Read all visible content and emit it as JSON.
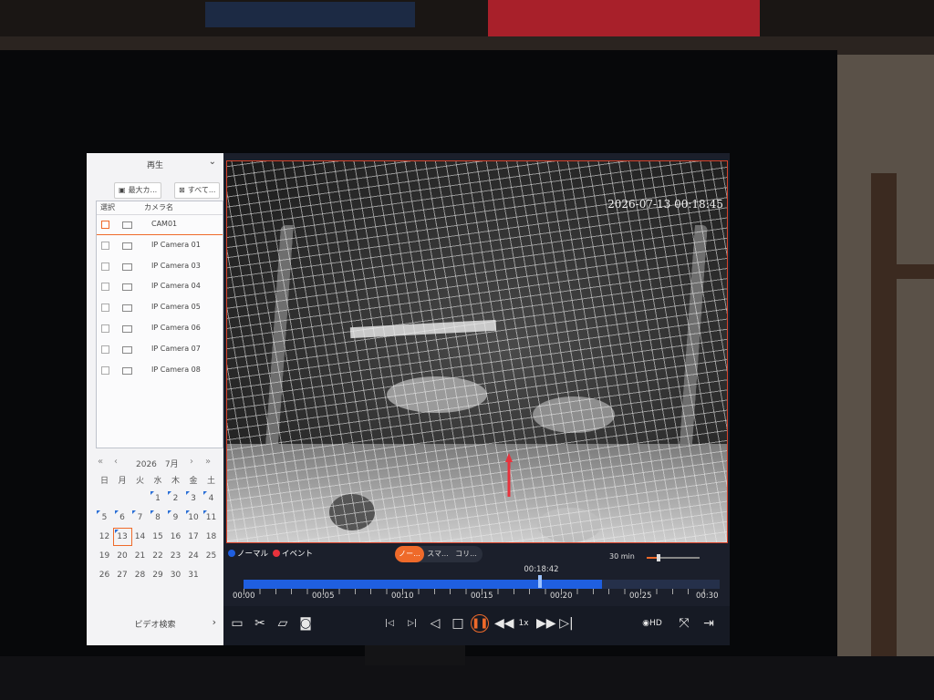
{
  "colors": {
    "accent": "#ef6a2a",
    "normal": "#1f5fe0",
    "event": "#e8323c"
  },
  "sidebar": {
    "title": "再生",
    "buttons": [
      {
        "label": "最大カ...",
        "icon": "grid-icon"
      },
      {
        "label": "すべて...",
        "icon": "close-all-icon"
      }
    ],
    "list_header": {
      "select": "選択",
      "camera": "カメラ名"
    },
    "cameras": [
      {
        "name": "CAM01",
        "active": true
      },
      {
        "name": "IP Camera 01"
      },
      {
        "name": "IP Camera 03"
      },
      {
        "name": "IP Camera 04"
      },
      {
        "name": "IP Camera 05"
      },
      {
        "name": "IP Camera 06"
      },
      {
        "name": "IP Camera 07"
      },
      {
        "name": "IP Camera 08"
      }
    ],
    "calendar": {
      "year": "2026",
      "month": "7月",
      "nav": [
        "«",
        "‹",
        "›",
        "»"
      ],
      "weekdays": [
        "日",
        "月",
        "火",
        "水",
        "木",
        "金",
        "土"
      ],
      "first_weekday": 3,
      "days": 31,
      "selected": 13,
      "recorded_days": [
        1,
        2,
        3,
        4,
        5,
        6,
        7,
        8,
        9,
        10,
        11,
        13
      ]
    },
    "video_search": "ビデオ検索"
  },
  "video": {
    "timestamp": "2026-07-13  00:18:45"
  },
  "timeline": {
    "legend": [
      {
        "label": "ノーマル",
        "color": "#1f5fe0"
      },
      {
        "label": "イベント",
        "color": "#e8323c"
      }
    ],
    "type_tabs": [
      "ノー...",
      "スマ...",
      "コリ..."
    ],
    "zoom_label": "30 min",
    "zoom_level": 0.22,
    "cursor_time": "00:18:42",
    "ticks": [
      "00:00",
      "00:05",
      "00:10",
      "00:15",
      "00:20",
      "00:25",
      "00:30"
    ],
    "range_minutes": 30,
    "recorded_until_min": 22.6,
    "cursor_min": 18.7
  },
  "controls": {
    "left": [
      "video-clip-icon",
      "scissors-icon",
      "folder-icon",
      "camera-snapshot-icon"
    ],
    "center": [
      "skip-back-30-icon",
      "skip-forward-30-icon",
      "reverse-play-icon",
      "stop-icon",
      "pause-icon",
      "slow-icon",
      "forward-icon",
      "step-frame-icon"
    ],
    "speed": "1x",
    "quality": "HD",
    "right": [
      "fullscreen-icon",
      "exit-icon"
    ]
  }
}
